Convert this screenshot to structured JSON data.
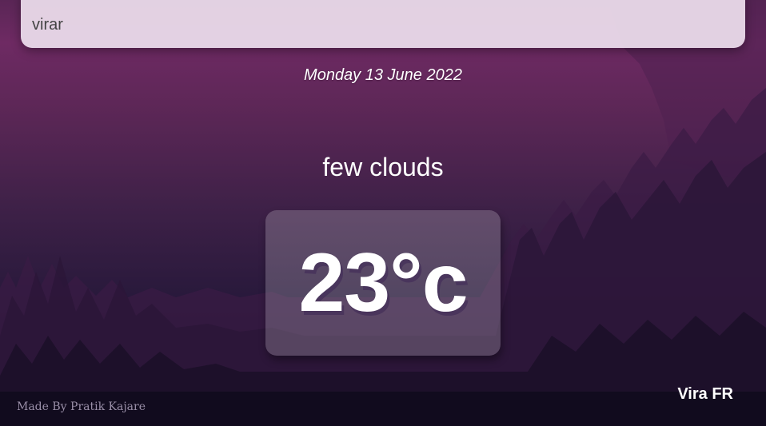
{
  "search": {
    "value": "virar"
  },
  "weather": {
    "date": "Monday 13 June 2022",
    "condition": "few clouds",
    "temperature": "23°c",
    "location": "Vira FR"
  },
  "footer": {
    "credit": "Made By Pratik Kajare"
  },
  "colors": {
    "background_top": "#6e2a63",
    "background_bottom": "#130d22",
    "search_box": "#e8d8e8",
    "credit_text": "#9a8fa8"
  }
}
